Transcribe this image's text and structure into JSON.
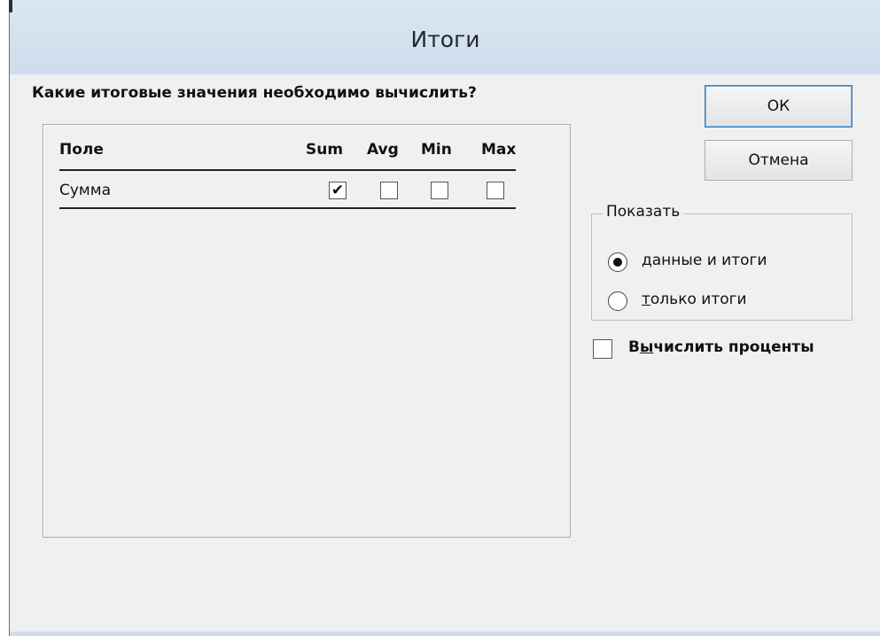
{
  "window": {
    "title": "Итоги"
  },
  "question": "Какие итоговые значения необходимо вычислить?",
  "table": {
    "headers": {
      "field": "Поле",
      "sum": "Sum",
      "avg": "Avg",
      "min": "Min",
      "max": "Max"
    },
    "rows": [
      {
        "field": "Сумма",
        "sum": true,
        "avg": false,
        "min": false,
        "max": false
      }
    ]
  },
  "buttons": {
    "ok": "ОК",
    "cancel": "Отмена"
  },
  "show_group": {
    "legend": "Показать",
    "options": [
      {
        "accel": "д",
        "rest": "анные и итоги",
        "selected": true
      },
      {
        "accel": "т",
        "rest": "олько итоги",
        "selected": false
      }
    ]
  },
  "percent_checkbox": {
    "pre": "В",
    "accel": "ы",
    "rest": "числить проценты",
    "checked": false
  },
  "glyphs": {
    "checkmark": "✔"
  }
}
